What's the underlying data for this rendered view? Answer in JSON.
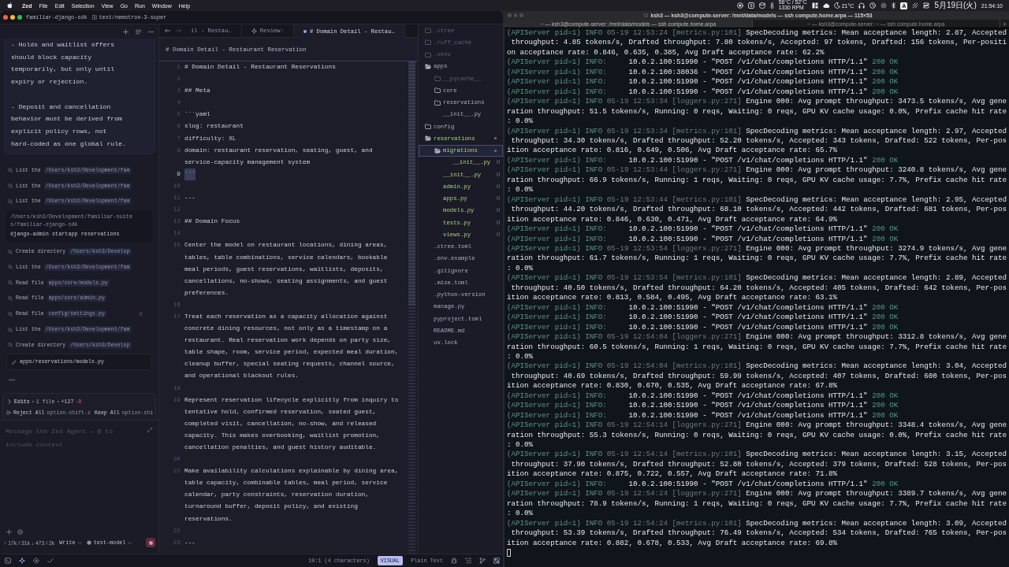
{
  "menu_bar": {
    "app": "Zed",
    "menus": [
      "File",
      "Edit",
      "Selection",
      "View",
      "Go",
      "Run",
      "Window",
      "Help"
    ],
    "temperatures": "56°C / 52°C",
    "fan": "1330 RPM",
    "weather": "21°C",
    "input_source": "A",
    "date": "5月19日(火)",
    "time": "21:54:10"
  },
  "editor_window": {
    "project": "familiar-django-sdk",
    "branch": "test/nemotron-3-super",
    "agent_panel": {
      "message": [
        "- Holds and waitlist offers should block capacity temporarily, but only until expiry or rejection.",
        "- Deposit and cancellation behavior must be derived from explicit policy rows, not hard-coded as one global rule."
      ],
      "activity": [
        {
          "kind": "tool",
          "label": "List the",
          "target": "/Users/ksh3/Development/fam",
          "error": false
        },
        {
          "kind": "tool",
          "label": "List the",
          "target": "/Users/ksh3/Development/fam",
          "error": false
        },
        {
          "kind": "tool",
          "label": "List the",
          "target": "/Users/ksh3/Development/fam",
          "error": false
        },
        {
          "kind": "command",
          "cwd": "/Users/ksh3/Development/familiar-suites/familiar-django-sdk",
          "command": "django-admin startapp reservations"
        },
        {
          "kind": "tool",
          "label": "Create directory",
          "target": "/Users/ksh3/Develop",
          "error": false
        },
        {
          "kind": "tool",
          "label": "List the",
          "target": "/Users/ksh3/Development/fam",
          "error": false
        },
        {
          "kind": "tool",
          "label": "Read file",
          "target": "apps/core/models.py",
          "error": false
        },
        {
          "kind": "tool",
          "label": "Read file",
          "target": "apps/core/admin.py",
          "error": false
        },
        {
          "kind": "tool",
          "label": "Read file",
          "target": "config/settings.py",
          "error": true
        },
        {
          "kind": "tool",
          "label": "List the",
          "target": "/Users/ksh3/Development/fam",
          "error": false
        },
        {
          "kind": "tool",
          "label": "Create directory",
          "target": "/Users/ksh3/Develop",
          "error": false
        },
        {
          "kind": "edit",
          "file": "apps/reservations/models.py"
        }
      ],
      "edits": {
        "title": "Edits",
        "files": "1 file",
        "added": "+127",
        "removed": "-0",
        "expanded": false,
        "reject": "Reject All",
        "reject_keys": "option-shift-z",
        "keep": "Keep All",
        "keep_keys": "option-shi"
      },
      "input": {
        "placeholder": "Message the Zed Agent — @ to include context"
      },
      "usage": "↑ 17k / 31k ↓ 473 / 2k",
      "profile": "Write",
      "model": "test-model",
      "generating": true
    },
    "editor": {
      "tabs": [
        {
          "label": "il - Restau…",
          "kind": "file",
          "selected": false,
          "modified": false
        },
        {
          "label": "Review:",
          "kind": "review",
          "selected": false,
          "modified": false
        },
        {
          "label": "# Domain Detail - Restau…",
          "kind": "file",
          "selected": true,
          "modified": true
        }
      ],
      "breadcrumb": "# Domain Detail - Restaurant Reservation",
      "lines": [
        {
          "number": "1",
          "text": "# Domain Detail - Restaurant Reservations",
          "selected": false
        },
        {
          "number": "2",
          "selected": false
        },
        {
          "number": "3",
          "text": "## Meta",
          "selected": false
        },
        {
          "number": "4",
          "selected": false
        },
        {
          "number": "5",
          "text": "```yaml",
          "selected": false
        },
        {
          "number": "6",
          "text": "slug: restaurant",
          "selected": false
        },
        {
          "number": "7",
          "text": "difficulty: XL",
          "selected": false
        },
        {
          "number": "8",
          "text": "domain: restaurant reservation, seating, guest, and service-capacity management system",
          "selected": false
        },
        {
          "number": "9",
          "text": "```",
          "selected": true
        },
        {
          "number": "10",
          "selected": false
        },
        {
          "number": "11",
          "text": "---",
          "selected": false
        },
        {
          "number": "12",
          "selected": false
        },
        {
          "number": "13",
          "text": "## Domain Focus",
          "selected": false
        },
        {
          "number": "14",
          "selected": false
        },
        {
          "number": "15",
          "text": "Center the model on restaurant locations, dining areas, tables, table combinations, service calendars, bookable meal periods, guest reservations, waitlists, deposits, cancellations, no-shows, seating assignments, and guest preferences.",
          "selected": false
        },
        {
          "number": "16",
          "selected": false
        },
        {
          "number": "17",
          "text": "Treat each reservation as a capacity allocation against concrete dining resources, not only as a timestamp on a restaurant. Real reservation work depends on party size, table shape, room, service period, expected meal duration, cleanup buffer, special seating requests, channel source, and operational blackout rules.",
          "selected": false
        },
        {
          "number": "18",
          "selected": false
        },
        {
          "number": "19",
          "text": "Represent reservation lifecycle explicitly from inquiry to tentative hold, confirmed reservation, seated guest, completed visit, cancellation, no-show, and released capacity. This makes overbooking, waitlist promotion, cancellation penalties, and guest history auditable.",
          "selected": false
        },
        {
          "number": "20",
          "selected": false
        },
        {
          "number": "21",
          "text": "Make availability calculations explainable by dining area, table capacity, combinable tables, meal period, service calendar, party constraints, reservation duration, turnaround buffer, deposit policy, and existing reservations.",
          "selected": false
        },
        {
          "number": "22",
          "selected": false
        },
        {
          "number": "23",
          "text": "---",
          "selected": false
        }
      ]
    },
    "project_panel": {
      "items": [
        {
          "name": ".ctree",
          "kind": "folder",
          "expanded": false,
          "ignored": true,
          "untracked": false,
          "selected": false
        },
        {
          "name": ".ruff_cache",
          "kind": "folder",
          "expanded": false,
          "ignored": true,
          "untracked": false,
          "selected": false
        },
        {
          "name": ".venv",
          "kind": "folder",
          "expanded": false,
          "ignored": true,
          "untracked": false,
          "selected": false
        },
        {
          "name": "apps",
          "kind": "folder",
          "expanded": true,
          "ignored": false,
          "untracked": false,
          "selected": false,
          "children": [
            {
              "name": "__pycache__",
              "kind": "folder",
              "expanded": false,
              "ignored": true,
              "untracked": false,
              "selected": false
            },
            {
              "name": "core",
              "kind": "folder",
              "expanded": false,
              "ignored": false,
              "untracked": false,
              "selected": false
            },
            {
              "name": "reservations",
              "kind": "folder",
              "expanded": false,
              "ignored": false,
              "untracked": false,
              "selected": false
            },
            {
              "name": "__init__.py",
              "kind": "file",
              "ignored": false,
              "untracked": false,
              "selected": false
            }
          ]
        },
        {
          "name": "config",
          "kind": "folder",
          "expanded": false,
          "ignored": false,
          "untracked": false,
          "selected": false
        },
        {
          "name": "reservations",
          "kind": "folder",
          "expanded": true,
          "ignored": false,
          "untracked": true,
          "selected": false,
          "children": [
            {
              "name": "migrations",
              "kind": "folder",
              "expanded": true,
              "ignored": false,
              "untracked": true,
              "selected": true,
              "children": [
                {
                  "name": "__init__.py",
                  "kind": "file",
                  "ignored": false,
                  "untracked": true,
                  "selected": false,
                  "badge": "U"
                }
              ]
            },
            {
              "name": "__init__.py",
              "kind": "file",
              "ignored": false,
              "untracked": true,
              "selected": false,
              "badge": "U"
            },
            {
              "name": "admin.py",
              "kind": "file",
              "ignored": false,
              "untracked": true,
              "selected": false,
              "badge": "U"
            },
            {
              "name": "apps.py",
              "kind": "file",
              "ignored": false,
              "untracked": true,
              "selected": false,
              "badge": "U"
            },
            {
              "name": "models.py",
              "kind": "file",
              "ignored": false,
              "untracked": true,
              "selected": false,
              "badge": "U"
            },
            {
              "name": "tests.py",
              "kind": "file",
              "ignored": false,
              "untracked": true,
              "selected": false,
              "badge": "U"
            },
            {
              "name": "views.py",
              "kind": "file",
              "ignored": false,
              "untracked": true,
              "selected": false,
              "badge": "U"
            }
          ]
        },
        {
          "name": ".ctree.toml",
          "kind": "file",
          "ignored": false,
          "untracked": false,
          "selected": false
        },
        {
          "name": ".env.example",
          "kind": "file",
          "ignored": false,
          "untracked": false,
          "selected": false
        },
        {
          "name": ".gitignore",
          "kind": "file",
          "ignored": false,
          "untracked": false,
          "selected": false
        },
        {
          "name": ".mise.toml",
          "kind": "file",
          "ignored": false,
          "untracked": false,
          "selected": false
        },
        {
          "name": ".python-version",
          "kind": "file",
          "ignored": false,
          "untracked": false,
          "selected": false
        },
        {
          "name": "manage.py",
          "kind": "file",
          "ignored": false,
          "untracked": false,
          "selected": false
        },
        {
          "name": "pyproject.toml",
          "kind": "file",
          "ignored": false,
          "untracked": false,
          "selected": false
        },
        {
          "name": "README.md",
          "kind": "file",
          "ignored": false,
          "untracked": false,
          "selected": false
        },
        {
          "name": "uv.lock",
          "kind": "file",
          "ignored": false,
          "untracked": false,
          "selected": false
        }
      ]
    },
    "status_bar": {
      "cursor": "10:1 (4 characters)",
      "mode": "VISUAL",
      "language": "Plain Text"
    }
  },
  "terminal": {
    "title": "ksh3 — ksh3@compute-server: /mnt/data/models — ssh compute.home.arpa — 115×53",
    "tabs": [
      {
        "label": "~ — ksh3@compute-server: /mnt/data/models — ssh compute.home.arpa",
        "selected": true
      },
      {
        "label": "~ — ksh3@compute-server: ~ — ssh compute.home.arpa",
        "selected": false
      }
    ],
    "lines": [
      {
        "source": "(APIServer pid=1)",
        "level": "INFO",
        "meta": "05-19 12:53:24 [metrics.py:101]",
        "text": "SpecDecoding metrics: Mean acceptance length: 2.87, Accepted"
      },
      {
        "text": " throughput: 4.85 tokens/s, Drafted throughput: 7.80 tokens/s, Accepted: 97 tokens, Drafted: 156 tokens, Per-positi"
      },
      {
        "text": "on acceptance rate: 0.846, 0.635, 0.385, Avg Draft acceptance rate: 62.2%"
      },
      {
        "source": "(APIServer pid=1)",
        "level": "INFO:",
        "text": "    10.0.2.100:51990 - \"POST /v1/chat/completions HTTP/1.1\"",
        "status": "200 OK"
      },
      {
        "source": "(APIServer pid=1)",
        "level": "INFO:",
        "text": "    10.0.2.100:38036 - \"POST /v1/chat/completions HTTP/1.1\"",
        "status": "200 OK"
      },
      {
        "source": "(APIServer pid=1)",
        "level": "INFO:",
        "text": "    10.0.2.100:51990 - \"POST /v1/chat/completions HTTP/1.1\"",
        "status": "200 OK"
      },
      {
        "source": "(APIServer pid=1)",
        "level": "INFO:",
        "text": "    10.0.2.100:51990 - \"POST /v1/chat/completions HTTP/1.1\"",
        "status": "200 OK"
      },
      {
        "source": "(APIServer pid=1)",
        "level": "INFO",
        "meta": "05-19 12:53:34 [loggers.py:271]",
        "text": "Engine 000: Avg prompt throughput: 3473.5 tokens/s, Avg gene"
      },
      {
        "text": "ration throughput: 51.5 tokens/s, Running: 0 reqs, Waiting: 0 reqs, GPU KV cache usage: 0.0%, Prefix cache hit rate"
      },
      {
        "text": ": 0.0%"
      },
      {
        "source": "(APIServer pid=1)",
        "level": "INFO",
        "meta": "05-19 12:53:34 [metrics.py:101]",
        "text": "SpecDecoding metrics: Mean acceptance length: 2.97, Accepted"
      },
      {
        "text": " throughput: 34.30 tokens/s, Drafted throughput: 52.20 tokens/s, Accepted: 343 tokens, Drafted: 522 tokens, Per-pos"
      },
      {
        "text": "ition acceptance rate: 0.816, 0.649, 0.506, Avg Draft acceptance rate: 65.7%"
      },
      {
        "source": "(APIServer pid=1)",
        "level": "INFO:",
        "text": "    10.0.2.100:51990 - \"POST /v1/chat/completions HTTP/1.1\"",
        "status": "200 OK"
      },
      {
        "source": "(APIServer pid=1)",
        "level": "INFO",
        "meta": "05-19 12:53:44 [loggers.py:271]",
        "text": "Engine 000: Avg prompt throughput: 3240.8 tokens/s, Avg gene"
      },
      {
        "text": "ration throughput: 66.9 tokens/s, Running: 1 reqs, Waiting: 0 reqs, GPU KV cache usage: 7.7%, Prefix cache hit rate"
      },
      {
        "text": ": 0.0%"
      },
      {
        "source": "(APIServer pid=1)",
        "level": "INFO",
        "meta": "05-19 12:53:44 [metrics.py:101]",
        "text": "SpecDecoding metrics: Mean acceptance length: 2.95, Accepted"
      },
      {
        "text": " throughput: 44.20 tokens/s, Drafted throughput: 68.10 tokens/s, Accepted: 442 tokens, Drafted: 681 tokens, Per-pos"
      },
      {
        "text": "ition acceptance rate: 0.846, 0.630, 0.471, Avg Draft acceptance rate: 64.9%"
      },
      {
        "source": "(APIServer pid=1)",
        "level": "INFO:",
        "text": "    10.0.2.100:51990 - \"POST /v1/chat/completions HTTP/1.1\"",
        "status": "200 OK"
      },
      {
        "source": "(APIServer pid=1)",
        "level": "INFO:",
        "text": "    10.0.2.100:51990 - \"POST /v1/chat/completions HTTP/1.1\"",
        "status": "200 OK"
      },
      {
        "source": "(APIServer pid=1)",
        "level": "INFO",
        "meta": "05-19 12:53:54 [loggers.py:271]",
        "text": "Engine 000: Avg prompt throughput: 3274.9 tokens/s, Avg gene"
      },
      {
        "text": "ration throughput: 61.7 tokens/s, Running: 1 reqs, Waiting: 0 reqs, GPU KV cache usage: 7.7%, Prefix cache hit rate"
      },
      {
        "text": ": 0.0%"
      },
      {
        "source": "(APIServer pid=1)",
        "level": "INFO",
        "meta": "05-19 12:53:54 [metrics.py:101]",
        "text": "SpecDecoding metrics: Mean acceptance length: 2.89, Accepted"
      },
      {
        "text": " throughput: 40.50 tokens/s, Drafted throughput: 64.20 tokens/s, Accepted: 405 tokens, Drafted: 642 tokens, Per-pos"
      },
      {
        "text": "ition acceptance rate: 0.813, 0.584, 0.495, Avg Draft acceptance rate: 63.1%"
      },
      {
        "source": "(APIServer pid=1)",
        "level": "INFO:",
        "text": "    10.0.2.100:51990 - \"POST /v1/chat/completions HTTP/1.1\"",
        "status": "200 OK"
      },
      {
        "source": "(APIServer pid=1)",
        "level": "INFO:",
        "text": "    10.0.2.100:51990 - \"POST /v1/chat/completions HTTP/1.1\"",
        "status": "200 OK"
      },
      {
        "source": "(APIServer pid=1)",
        "level": "INFO:",
        "text": "    10.0.2.100:51990 - \"POST /v1/chat/completions HTTP/1.1\"",
        "status": "200 OK"
      },
      {
        "source": "(APIServer pid=1)",
        "level": "INFO",
        "meta": "05-19 12:54:04 [loggers.py:271]",
        "text": "Engine 000: Avg prompt throughput: 3312.8 tokens/s, Avg gene"
      },
      {
        "text": "ration throughput: 60.5 tokens/s, Running: 1 reqs, Waiting: 0 reqs, GPU KV cache usage: 7.7%, Prefix cache hit rate"
      },
      {
        "text": ": 0.0%"
      },
      {
        "source": "(APIServer pid=1)",
        "level": "INFO",
        "meta": "05-19 12:54:04 [metrics.py:101]",
        "text": "SpecDecoding metrics: Mean acceptance length: 3.04, Accepted"
      },
      {
        "text": " throughput: 40.69 tokens/s, Drafted throughput: 59.99 tokens/s, Accepted: 407 tokens, Drafted: 600 tokens, Per-pos"
      },
      {
        "text": "ition acceptance rate: 0.830, 0.670, 0.535, Avg Draft acceptance rate: 67.8%"
      },
      {
        "source": "(APIServer pid=1)",
        "level": "INFO:",
        "text": "    10.0.2.100:51990 - \"POST /v1/chat/completions HTTP/1.1\"",
        "status": "200 OK"
      },
      {
        "source": "(APIServer pid=1)",
        "level": "INFO:",
        "text": "    10.0.2.100:51990 - \"POST /v1/chat/completions HTTP/1.1\"",
        "status": "200 OK"
      },
      {
        "source": "(APIServer pid=1)",
        "level": "INFO:",
        "text": "    10.0.2.100:51990 - \"POST /v1/chat/completions HTTP/1.1\"",
        "status": "200 OK"
      },
      {
        "source": "(APIServer pid=1)",
        "level": "INFO",
        "meta": "05-19 12:54:14 [loggers.py:271]",
        "text": "Engine 000: Avg prompt throughput: 3348.4 tokens/s, Avg gene"
      },
      {
        "text": "ration throughput: 55.3 tokens/s, Running: 0 reqs, Waiting: 0 reqs, GPU KV cache usage: 0.0%, Prefix cache hit rate"
      },
      {
        "text": ": 0.0%"
      },
      {
        "source": "(APIServer pid=1)",
        "level": "INFO",
        "meta": "05-19 12:54:14 [metrics.py:101]",
        "text": "SpecDecoding metrics: Mean acceptance length: 3.15, Accepted"
      },
      {
        "text": " throughput: 37.90 tokens/s, Drafted throughput: 52.80 tokens/s, Accepted: 379 tokens, Drafted: 528 tokens, Per-pos"
      },
      {
        "text": "ition acceptance rate: 0.875, 0.722, 0.557, Avg Draft acceptance rate: 71.8%"
      },
      {
        "source": "(APIServer pid=1)",
        "level": "INFO:",
        "text": "    10.0.2.100:51990 - \"POST /v1/chat/completions HTTP/1.1\"",
        "status": "200 OK"
      },
      {
        "source": "(APIServer pid=1)",
        "level": "INFO",
        "meta": "05-19 12:54:24 [loggers.py:271]",
        "text": "Engine 000: Avg prompt throughput: 3389.7 tokens/s, Avg gene"
      },
      {
        "text": "ration throughput: 78.9 tokens/s, Running: 1 reqs, Waiting: 0 reqs, GPU KV cache usage: 7.7%, Prefix cache hit rate"
      },
      {
        "text": ": 0.0%"
      },
      {
        "source": "(APIServer pid=1)",
        "level": "INFO",
        "meta": "05-19 12:54:24 [metrics.py:101]",
        "text": "SpecDecoding metrics: Mean acceptance length: 3.09, Accepted"
      },
      {
        "text": " throughput: 53.39 tokens/s, Drafted throughput: 76.49 tokens/s, Accepted: 534 tokens, Drafted: 765 tokens, Per-pos"
      },
      {
        "text": "ition acceptance rate: 0.882, 0.678, 0.533, Avg Draft acceptance rate: 69.8%"
      }
    ]
  }
}
